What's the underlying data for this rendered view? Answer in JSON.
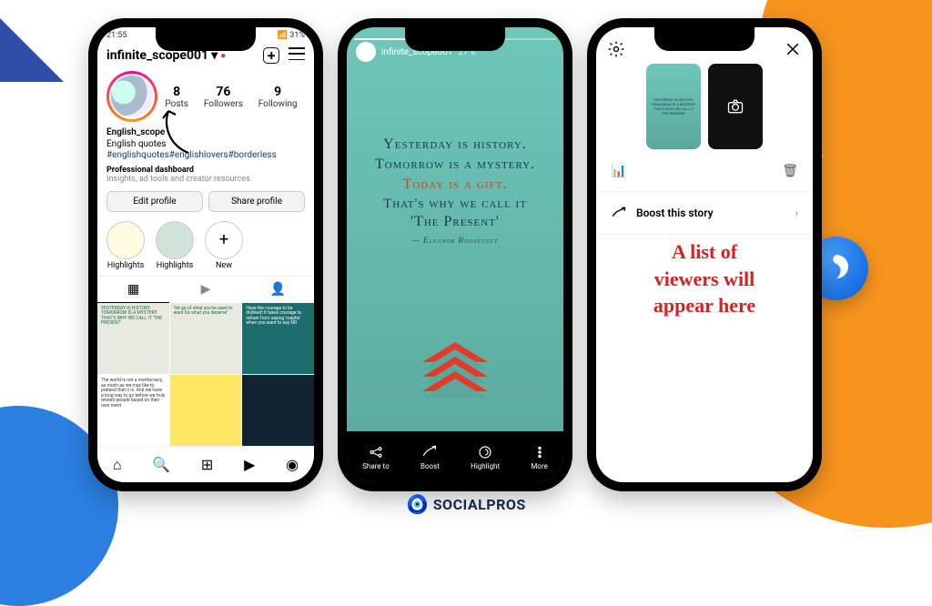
{
  "brand": "SOCIALPROS",
  "phone1": {
    "status_time": "21:55",
    "status_right": "📶 31%",
    "username": "infinite_scope001",
    "stats": {
      "posts_n": "8",
      "posts_l": "Posts",
      "followers_n": "76",
      "followers_l": "Followers",
      "following_n": "9",
      "following_l": "Following"
    },
    "bio_name": "English_scope",
    "bio_line": "English quotes",
    "bio_tags": "#englishquotes#englishlovers#borderless",
    "dash_title": "Professional dashboard",
    "dash_sub": "Insights, ad tools and creator resources.",
    "edit_btn": "Edit profile",
    "share_btn": "Share profile",
    "hl1": "Highlights",
    "hl2": "Highlights",
    "hl_new": "New",
    "cell_quote": "YESTERDAY IS HISTORY. TOMORROW IS A MYSTERY. THAT'S WHY WE CALL IT 'THE PRESENT'",
    "cell_mid": "\"let go of what you've used to want for what you deserve\"",
    "cell_right": "Have the courage to be disliked! It takes courage to refrain from saying 'maybe' when you want to say NO",
    "cell_bl": "The world is not a meritocracy, as much as we may like to pretend that it is. And we have a long way to go before we truly reward people based on their own merit"
  },
  "phone2": {
    "username": "infinite_scope001",
    "time": "27 s",
    "q1": "Yesterday is history.",
    "q2": "Tomorrow is a mystery.",
    "q3": "Today is a gift.",
    "q4": "That's why we call it",
    "q5": "'The Present'",
    "author": "— Eleanor Roosevelt",
    "share": "Share to",
    "boost": "Boost",
    "highlight": "Highlight",
    "more": "More"
  },
  "phone3": {
    "boost_label": "Boost this story",
    "note_l1": "A list of",
    "note_l2": "viewers will",
    "note_l3": "appear here"
  }
}
